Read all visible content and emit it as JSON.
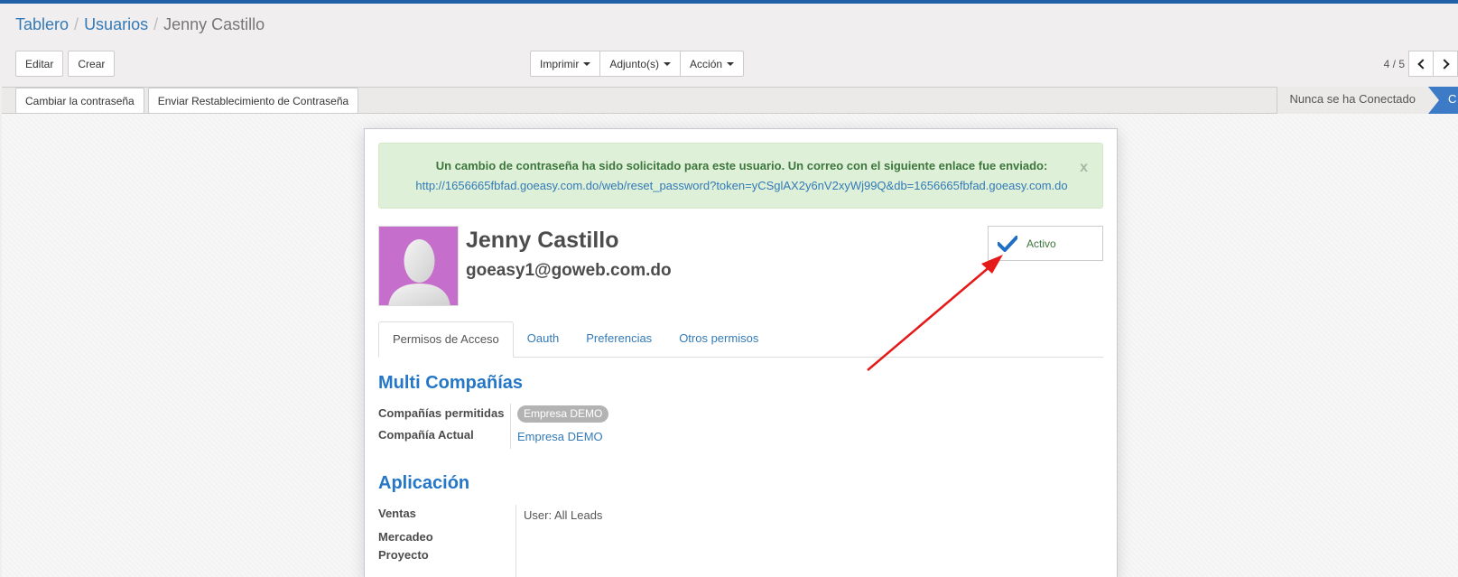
{
  "breadcrumb": {
    "items": [
      "Tablero",
      "Usuarios"
    ],
    "current": "Jenny Castillo"
  },
  "toolbar": {
    "edit_label": "Editar",
    "create_label": "Crear",
    "print_label": "Imprimir",
    "attach_label": "Adjunto(s)",
    "action_label": "Acción"
  },
  "pager": {
    "value": "4 / 5"
  },
  "status_buttons": {
    "change_password": "Cambiar la contraseña",
    "send_reset": "Enviar Restablecimiento de Contraseña"
  },
  "states": {
    "never_connected": "Nunca se ha Conectado",
    "confirmed_partial": "C"
  },
  "alert": {
    "title": "Un cambio de contraseña ha sido solicitado para este usuario. Un correo con el siguiente enlace fue enviado:",
    "link": "http://1656665fbfad.goeasy.com.do/web/reset_password?token=yCSglAX2y6nV2xyWj99Q&db=1656665fbfad.goeasy.com.do",
    "close": "x"
  },
  "user": {
    "name": "Jenny Castillo",
    "login": "goeasy1@goweb.com.do",
    "active_label": "Activo"
  },
  "tabs": [
    "Permisos de Acceso",
    "Oauth",
    "Preferencias",
    "Otros permisos"
  ],
  "multi_company": {
    "title": "Multi Compañías",
    "allowed_label": "Compañías permitidas",
    "allowed_value": "Empresa DEMO",
    "current_label": "Compañía Actual",
    "current_value": "Empresa DEMO"
  },
  "application": {
    "title": "Aplicación",
    "sales_label": "Ventas",
    "sales_value": "User: All Leads",
    "marketing_label": "Mercadeo",
    "project_label": "Proyecto"
  },
  "colors": {
    "accent": "#337ab7",
    "alert_bg": "#dff0d8",
    "alert_text": "#3c763d",
    "avatar_bg": "#c56ecb",
    "arrow": "#e61919",
    "check": "#1f6fc4"
  }
}
